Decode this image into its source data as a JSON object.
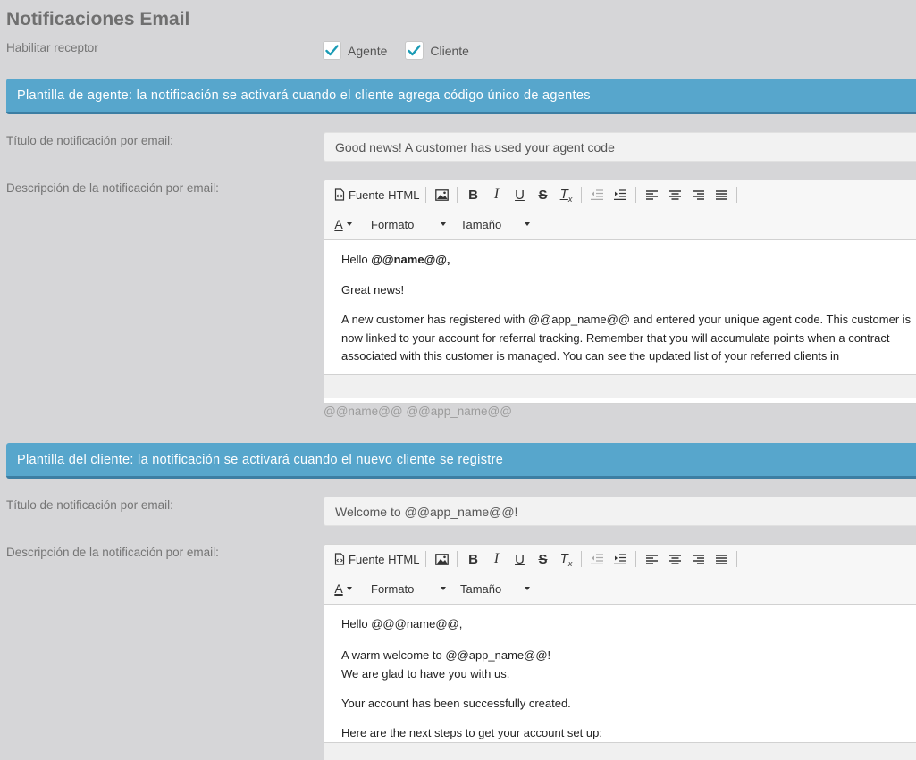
{
  "page_title": "Notificaciones Email",
  "receptor": {
    "label": "Habilitar receptor",
    "options": [
      {
        "label": "Agente",
        "checked": true
      },
      {
        "label": "Cliente",
        "checked": true
      }
    ]
  },
  "colors": {
    "header": "#57a6cc",
    "check": "#1a9bb5"
  },
  "toolbar": {
    "source_label": "Fuente HTML",
    "format_label": "Formato",
    "size_label": "Tamaño",
    "icons": [
      "source-icon",
      "image-icon",
      "bold-icon",
      "italic-icon",
      "underline-icon",
      "strike-icon",
      "clear-format-icon",
      "outdent-icon",
      "indent-icon",
      "align-left-icon",
      "align-center-icon",
      "align-right-icon",
      "justify-icon",
      "text-color-icon"
    ]
  },
  "agent": {
    "header": "Plantilla de agente: la notificación se activará cuando el cliente agrega código único de agentes",
    "title_label": "Título de notificación por email:",
    "title_value": "Good news! A customer has used your agent code",
    "desc_label": "Descripción de la notificación por email:",
    "body": {
      "greeting_prefix": "Hello ",
      "greeting_bold": "@@name@@,",
      "p2": "Great news!",
      "p3": "A new customer has registered with @@app_name@@ and entered your unique agent code. This customer is now linked to your account for referral tracking. Remember that you will accumulate points when a contract associated with this customer is managed. You can see the updated list of your referred clients in"
    },
    "variables": "@@name@@ @@app_name@@"
  },
  "client": {
    "header": "Plantilla del cliente: la notificación se activará cuando el nuevo cliente se registre",
    "title_label": "Título de notificación por email:",
    "title_value": "Welcome to @@app_name@@!",
    "desc_label": "Descripción de la notificación por email:",
    "body": {
      "p1": "Hello @@@name@@,",
      "p2a": "A warm welcome to @@app_name@@!",
      "p2b": "We are glad to have you with us.",
      "p3": "Your account has been successfully created.",
      "p4": "Here are the next steps to get your account set up:"
    }
  }
}
